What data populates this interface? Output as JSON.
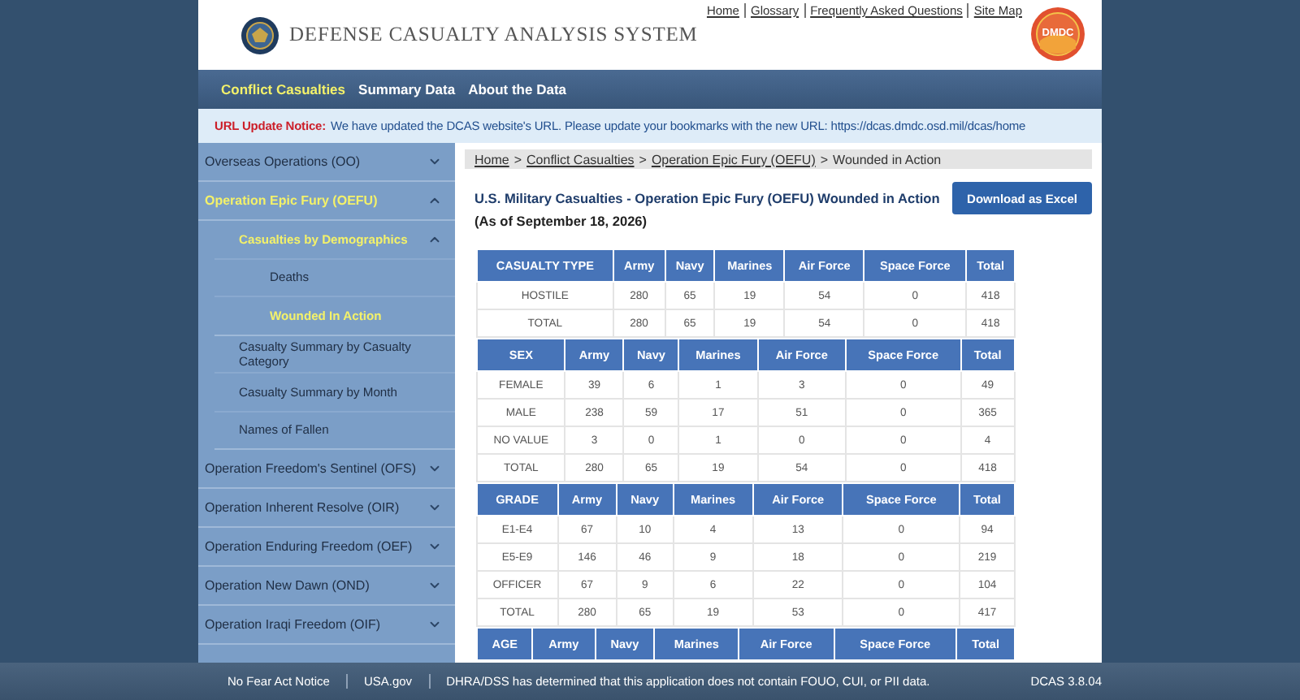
{
  "header": {
    "title": "DEFENSE CASUALTY ANALYSIS SYSTEM",
    "links": [
      {
        "label": "Home"
      },
      {
        "label": "Glossary"
      },
      {
        "label": "Frequently Asked Questions"
      },
      {
        "label": "Site Map"
      }
    ],
    "logo_text": "DMDC"
  },
  "nav": [
    {
      "label": "Conflict Casualties",
      "selected": true
    },
    {
      "label": "Summary Data",
      "selected": false
    },
    {
      "label": "About the Data",
      "selected": false
    }
  ],
  "notice": {
    "label": "URL Update Notice:",
    "text": "We have updated the DCAS website's URL. Please update your bookmarks with the new URL: https://dcas.dmdc.osd.mil/dcas/home"
  },
  "sidebar": {
    "items": [
      {
        "label": "Overseas Operations (OO)",
        "selected": false,
        "expanded": false
      },
      {
        "label": "Operation Epic Fury (OEFU)",
        "selected": true,
        "expanded": true,
        "children": [
          {
            "label": "Casualties by Demographics",
            "selected": true,
            "expanded": true,
            "children": [
              {
                "label": "Deaths",
                "selected": false
              },
              {
                "label": "Wounded In Action",
                "selected": true
              }
            ]
          },
          {
            "label": "Casualty Summary by Casualty Category",
            "selected": false
          },
          {
            "label": "Casualty Summary by Month",
            "selected": false
          },
          {
            "label": "Names of Fallen",
            "selected": false
          }
        ]
      },
      {
        "label": "Operation Freedom's Sentinel (OFS)",
        "selected": false,
        "expanded": false
      },
      {
        "label": "Operation Inherent Resolve (OIR)",
        "selected": false,
        "expanded": false
      },
      {
        "label": "Operation Enduring Freedom (OEF)",
        "selected": false,
        "expanded": false
      },
      {
        "label": "Operation New Dawn (OND)",
        "selected": false,
        "expanded": false
      },
      {
        "label": "Operation Iraqi Freedom (OIF)",
        "selected": false,
        "expanded": false
      }
    ]
  },
  "breadcrumb": {
    "separator": ">",
    "items": [
      {
        "label": "Home",
        "link": true
      },
      {
        "label": "Conflict Casualties",
        "link": true
      },
      {
        "label": "Operation Epic Fury (OEFU)",
        "link": true
      },
      {
        "label": "Wounded in Action",
        "link": false
      }
    ]
  },
  "heading": {
    "title": "U.S. Military Casualties - Operation Epic Fury (OEFU) Wounded in Action",
    "subtitle": "(As of September 18, 2026)"
  },
  "download_button": "Download as Excel",
  "tables": [
    {
      "columns": [
        "CASUALTY TYPE",
        "Army",
        "Navy",
        "Marines",
        "Air Force",
        "Space Force",
        "Total"
      ],
      "rows": [
        [
          "HOSTILE",
          "280",
          "65",
          "19",
          "54",
          "0",
          "418"
        ],
        [
          "TOTAL",
          "280",
          "65",
          "19",
          "54",
          "0",
          "418"
        ]
      ]
    },
    {
      "columns": [
        "SEX",
        "Army",
        "Navy",
        "Marines",
        "Air Force",
        "Space Force",
        "Total"
      ],
      "rows": [
        [
          "FEMALE",
          "39",
          "6",
          "1",
          "3",
          "0",
          "49"
        ],
        [
          "MALE",
          "238",
          "59",
          "17",
          "51",
          "0",
          "365"
        ],
        [
          "NO VALUE",
          "3",
          "0",
          "1",
          "0",
          "0",
          "4"
        ],
        [
          "TOTAL",
          "280",
          "65",
          "19",
          "54",
          "0",
          "418"
        ]
      ]
    },
    {
      "columns": [
        "GRADE",
        "Army",
        "Navy",
        "Marines",
        "Air Force",
        "Space Force",
        "Total"
      ],
      "rows": [
        [
          "E1-E4",
          "67",
          "10",
          "4",
          "13",
          "0",
          "94"
        ],
        [
          "E5-E9",
          "146",
          "46",
          "9",
          "18",
          "0",
          "219"
        ],
        [
          "OFFICER",
          "67",
          "9",
          "6",
          "22",
          "0",
          "104"
        ],
        [
          "TOTAL",
          "280",
          "65",
          "19",
          "53",
          "0",
          "417"
        ]
      ]
    },
    {
      "columns": [
        "AGE",
        "Army",
        "Navy",
        "Marines",
        "Air Force",
        "Space Force",
        "Total"
      ]
    }
  ],
  "footer": {
    "links": [
      {
        "label": "No Fear Act Notice"
      },
      {
        "label": "USA.gov"
      }
    ],
    "notice": "DHRA/DSS has determined that this application does not contain FOUO, CUI, or PII data.",
    "version": "DCAS 3.8.04"
  }
}
